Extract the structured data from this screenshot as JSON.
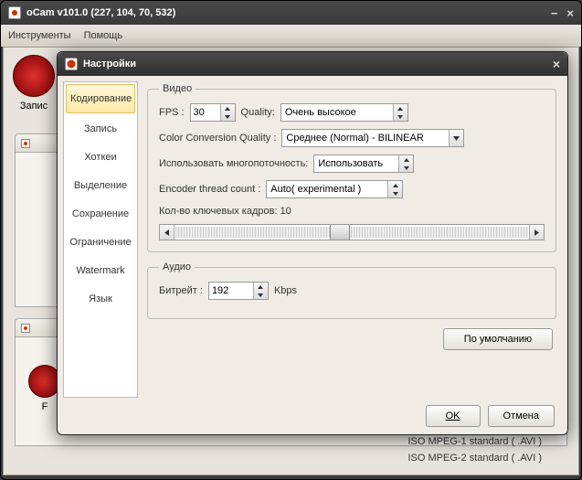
{
  "window": {
    "title": "oCam v101.0 (227, 104, 70, 532)"
  },
  "menubar": {
    "tools": "Инструменты",
    "help": "Помощь"
  },
  "main": {
    "record_label": "Запис"
  },
  "bg_list": {
    "item1": "ISO MPEG-1 standard ( .AVI )",
    "item2": "ISO MPEG-2 standard ( .AVI )"
  },
  "dialog": {
    "title": "Настройки",
    "tabs": {
      "encoding": "Кодирование",
      "record": "Запись",
      "hotkeys": "Хоткеи",
      "selection": "Выделение",
      "save": "Сохранение",
      "limit": "Ограничение",
      "watermark": "Watermark",
      "lang": "Язык"
    },
    "video": {
      "legend": "Видео",
      "fps_label": "FPS :",
      "fps_value": "30",
      "quality_label": "Quality:",
      "quality_value": "Очень высокое",
      "ccq_label": "Color Conversion Quality :",
      "ccq_value": "Среднее (Normal) - BILINEAR",
      "mt_label": "Использовать многопоточность:",
      "mt_value": "Использовать",
      "enc_label": "Encoder thread count :",
      "enc_value": "Auto( experimental )",
      "keyframe_label": "Кол-во ключевых кадров: 10"
    },
    "audio": {
      "legend": "Аудио",
      "bitrate_label": "Битрейт :",
      "bitrate_value": "192",
      "bitrate_unit": "Kbps"
    },
    "buttons": {
      "defaults": "По умолчанию",
      "ok": "OK",
      "cancel": "Отмена"
    }
  }
}
